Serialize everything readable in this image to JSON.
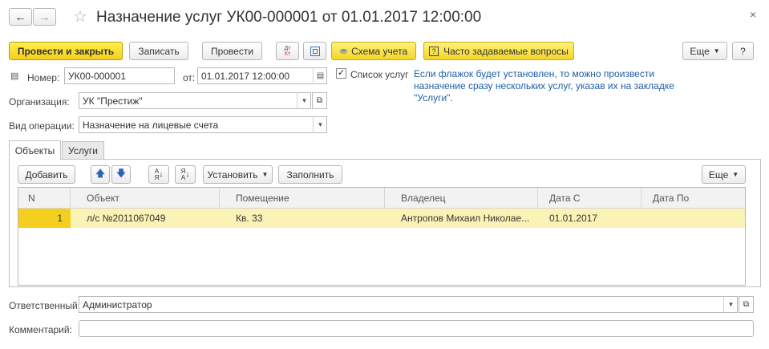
{
  "window": {
    "title": "Назначение услуг УК00-000001 от 01.01.2017 12:00:00"
  },
  "toolbar": {
    "post_close": "Провести и закрыть",
    "save": "Записать",
    "post": "Провести",
    "dt_kt": "Дт Кт",
    "scheme": "Схема учета",
    "faq": "Часто задаваемые вопросы",
    "more": "Еще",
    "help": "?"
  },
  "form": {
    "number_label": "Номер:",
    "number_value": "УК00-000001",
    "date_label": "от:",
    "date_value": "01.01.2017 12:00:00",
    "services_list_label": "Список услуг",
    "services_list_checked": true,
    "hint": "Если флажок будет установлен, то можно произвести назначение сразу нескольких услуг, указав их на закладке \"Услуги\".",
    "org_label": "Организация:",
    "org_value": "УК \"Престиж\"",
    "op_label": "Вид операции:",
    "op_value": "Назначение на лицевые счета",
    "responsible_label": "Ответственный:",
    "responsible_value": "Администратор",
    "comment_label": "Комментарий:",
    "comment_value": ""
  },
  "tabs": [
    {
      "label": "Объекты",
      "active": true
    },
    {
      "label": "Услуги",
      "active": false
    }
  ],
  "table_toolbar": {
    "add": "Добавить",
    "set": "Установить",
    "fill": "Заполнить",
    "more": "Еще"
  },
  "table": {
    "columns": [
      "N",
      "Объект",
      "Помещение",
      "Владелец",
      "Дата С",
      "Дата По"
    ],
    "rows": [
      {
        "n": "1",
        "object": "л/с №2011067049",
        "room": "Кв. 33",
        "owner": "Антропов Михаил Николае...",
        "date_from": "01.01.2017",
        "date_to": ""
      }
    ]
  },
  "colors": {
    "accent_yellow": "#f4cf1f",
    "selected_row": "#fbf3b5",
    "link_blue": "#1f5ea8"
  }
}
